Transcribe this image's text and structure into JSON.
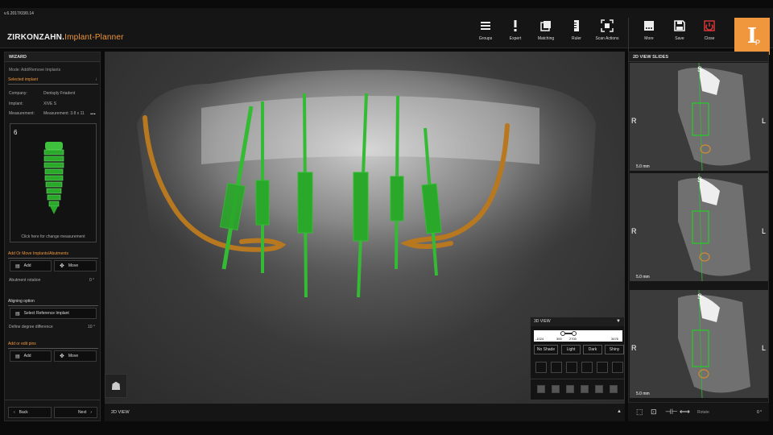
{
  "app": {
    "version": "v.6.2017/03/0.14",
    "brand_prefix": "ZIRKONZAHN.",
    "brand_suffix": "Implant-Planner",
    "logo_text": "I",
    "logo_sub": "P"
  },
  "toolbar": {
    "items": [
      {
        "label": "Groups",
        "icon": "list-icon"
      },
      {
        "label": "Expert",
        "icon": "exclamation-icon"
      },
      {
        "label": "Matching",
        "icon": "matching-icon"
      },
      {
        "label": "Ruler",
        "icon": "ruler-icon"
      },
      {
        "label": "Scan Actions",
        "icon": "scan-icon"
      },
      {
        "label": "More",
        "icon": "more-icon"
      },
      {
        "label": "Save",
        "icon": "save-icon"
      },
      {
        "label": "Close",
        "icon": "power-icon"
      }
    ],
    "close_color": "#e03a3a",
    "accent": "#f0963c"
  },
  "wizard": {
    "title": "WIZARD",
    "mode": "Mode: Add/Remove Implants",
    "selected_implant": "Selected implant",
    "company_label": "Company:",
    "company_value": "Dentsply Friadent",
    "implant_label": "Implant:",
    "implant_value": "XIVE S",
    "measurement_label": "Measurement:",
    "measurement_value": "Measurement: 3.8 x 11",
    "more": "...",
    "implant_number": "6",
    "change_measurement": "Click here for change measurement",
    "add_move_title": "Add Or Move Implants/Abutments",
    "add_label": "Add",
    "move_label": "Move",
    "abutment_rotation_label": "Abutment rotation",
    "abutment_rotation_value": "0 °",
    "aligning_title": "Aligning option",
    "select_reference": "Select Reference Implant",
    "degree_label": "Define degree difference",
    "degree_value": "10 °",
    "pins_title": "Add or edit pins",
    "pins_add": "Add",
    "pins_move": "Move",
    "back_label": "Back",
    "next_label": "Next"
  },
  "viewport": {
    "bottom_label": "2D VIEW",
    "implant_color": "#33bb33",
    "nerve_color": "#b87820"
  },
  "view3d": {
    "title": "3D VIEW",
    "slider_min": "-1024",
    "slider_low": "300",
    "slider_high": "2700",
    "slider_max": "3476",
    "shades": [
      "No Shade",
      "Light",
      "Dark",
      "Shiny"
    ]
  },
  "slices": {
    "title": "2D VIEW SLIDES",
    "top_label": "S",
    "left_label": "R",
    "right_label": "L",
    "scale_label": "5.0 mm",
    "rotate_label": "Rotate",
    "rotate_value": "0 °"
  }
}
